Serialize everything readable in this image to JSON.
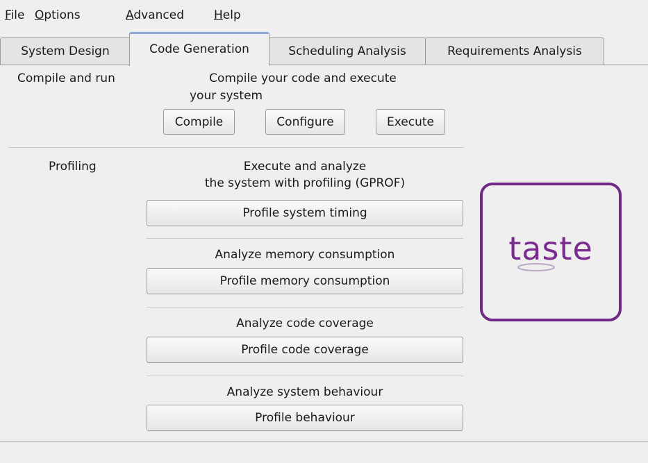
{
  "menu": {
    "items": [
      {
        "mnemonic": "F",
        "rest": "ile"
      },
      {
        "mnemonic": "O",
        "rest": "ptions"
      },
      {
        "mnemonic": "A",
        "rest": "dvanced"
      },
      {
        "mnemonic": "H",
        "rest": "elp"
      }
    ]
  },
  "tabs": [
    "System Design",
    "Code Generation",
    "Scheduling Analysis",
    "Requirements Analysis"
  ],
  "active_tab": "Code Generation",
  "compile_section": {
    "label": "Compile and run",
    "description_line1": "Compile your code and execute",
    "description_line2": "your system",
    "buttons": {
      "compile": "Compile",
      "configure": "Configure",
      "execute": "Execute"
    }
  },
  "profiling_section": {
    "label": "Profiling",
    "timing_desc_line1": "Execute and analyze",
    "timing_desc_line2": "the system with profiling (GPROF)",
    "timing_button": "Profile system timing",
    "memory_desc": "Analyze memory consumption",
    "memory_button": "Profile memory consumption",
    "coverage_desc": "Analyze code coverage",
    "coverage_button": "Profile code coverage",
    "behaviour_desc": "Analyze system behaviour",
    "behaviour_button": "Profile behaviour"
  },
  "logo": {
    "text": "taste",
    "color": "#7a2d8e",
    "border_color": "#6e2a84"
  },
  "colors": {
    "background": "#efefef",
    "active_tab_accent": "#8aa9d6"
  }
}
